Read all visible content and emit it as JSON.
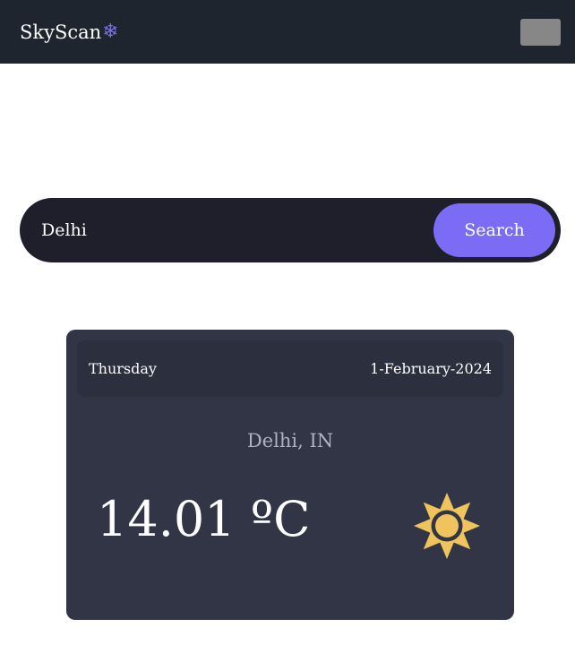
{
  "navbar": {
    "brand": "SkyScan",
    "brand_icon": "snowflake-icon",
    "menu_icon": "menu-toggle"
  },
  "search": {
    "value": "Delhi",
    "button_label": "Search"
  },
  "weather": {
    "day": "Thursday",
    "date": "1-February-2024",
    "location": "Delhi, IN",
    "temperature": "14.01 ºC",
    "icon": "sun-icon"
  },
  "colors": {
    "navbar_bg": "#1f252e",
    "accent": "#7c6cf5",
    "card_bg": "#323545",
    "sun": "#f0c45c"
  }
}
